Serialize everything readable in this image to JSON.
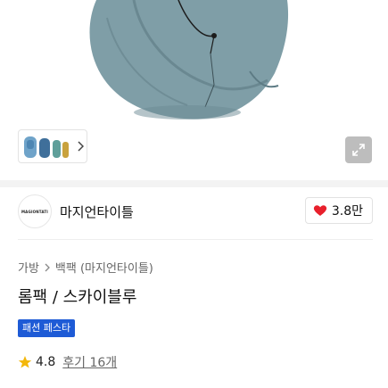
{
  "product_image": {
    "alt": "",
    "colors": {
      "bag": "#7f9ea7",
      "bag_dark": "#5d7b84",
      "strap": "#1c1c1c"
    }
  },
  "gallery": {
    "thumbnail_icon": "backpack-thumbnail",
    "next_icon": "chevron-right-icon",
    "zoom_icon": "expand-icon"
  },
  "brand": {
    "logo_text": "MAGIONTATI",
    "name": "마지언타이틀",
    "likes": "3.8만",
    "like_icon": "heart-icon",
    "like_color": "#e8202c"
  },
  "breadcrumb": {
    "items": [
      "가방",
      "백팩 (마지언타이틀)"
    ]
  },
  "product": {
    "title": "롬팩 / 스카이블루",
    "badge": "패션 페스타",
    "badge_color": "#1e5bd6"
  },
  "rating": {
    "score": "4.8",
    "reviews": "후기 16개",
    "star_color": "#f3b70b"
  }
}
